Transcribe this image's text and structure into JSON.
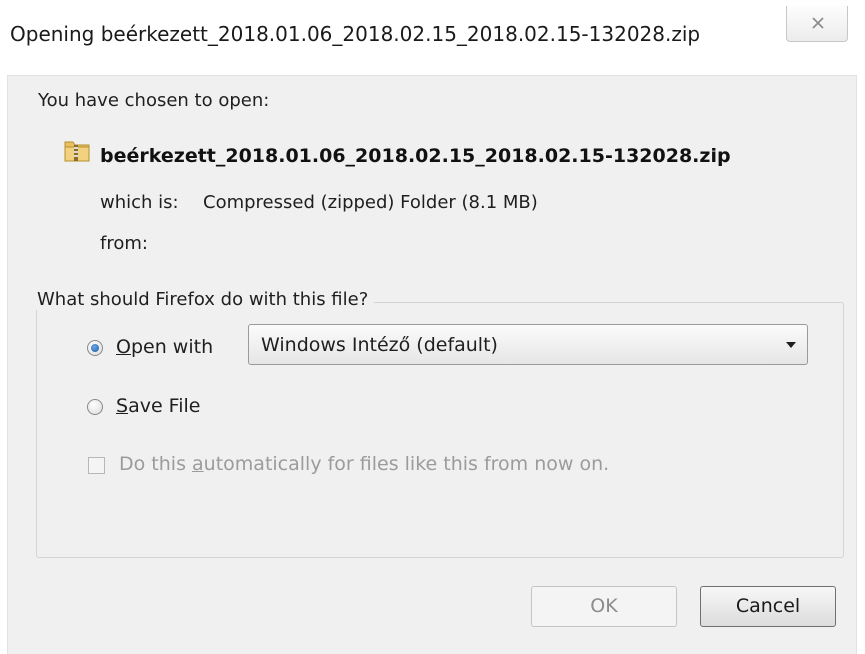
{
  "window": {
    "title": "Opening beérkezett_2018.01.06_2018.02.15_2018.02.15-132028.zip",
    "close_icon": "close-icon"
  },
  "dialog": {
    "intro": "You have chosen to open:",
    "file_icon": "zip-folder-icon",
    "file_name": "beérkezett_2018.01.06_2018.02.15_2018.02.15-132028.zip",
    "which_is_label": "which is:",
    "which_is_value": "Compressed (zipped) Folder (8.1 MB)",
    "from_label": "from:",
    "from_value": ""
  },
  "action_group": {
    "legend": "What should Firefox do with this file?",
    "open_with": {
      "accel": "O",
      "rest": "pen with",
      "checked": true
    },
    "save_file": {
      "accel": "S",
      "rest": "ave File",
      "checked": false
    },
    "application_select": {
      "value": "Windows Intéző (default)"
    },
    "auto_checkbox": {
      "pre": "Do this ",
      "accel": "a",
      "post": "utomatically for files like this from now on.",
      "checked": false,
      "enabled": false
    }
  },
  "buttons": {
    "ok": "OK",
    "cancel": "Cancel"
  },
  "colors": {
    "dialog_bg": "#f0f0f0",
    "radio_selected": "#1c5aa6",
    "disabled_text": "#9b9b9b"
  }
}
